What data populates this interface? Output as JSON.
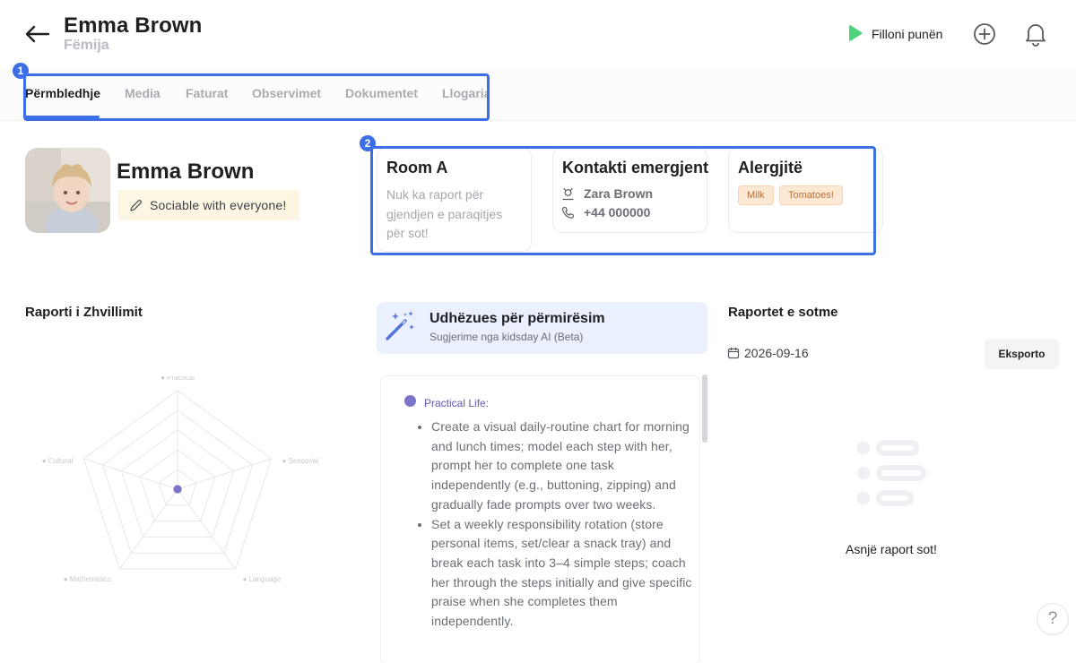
{
  "header": {
    "title": "Emma Brown",
    "subtitle": "Fëmija",
    "start_work_label": "Filloni punën",
    "accent": "#4cd37b"
  },
  "tabs": [
    {
      "label": "Përmbledhje",
      "active": true
    },
    {
      "label": "Media"
    },
    {
      "label": "Faturat"
    },
    {
      "label": "Observimet"
    },
    {
      "label": "Dokumentet"
    },
    {
      "label": "Llogaria"
    }
  ],
  "annotations": [
    "1",
    "2"
  ],
  "profile": {
    "name": "Emma Brown",
    "mood": "Sociable with everyone!"
  },
  "cards": {
    "room": {
      "title": "Room A",
      "text": "Nuk ka raport për gjendjen e paraqitjes për sot!"
    },
    "emergency": {
      "title": "Kontakti emergjent",
      "name": "Zara Brown",
      "phone": "+44 000000"
    },
    "allergies": {
      "title": "Alergjitë",
      "items": [
        "Milk",
        "Tomatoes!"
      ]
    }
  },
  "development": {
    "title": "Raporti i Zhvillimit"
  },
  "chart_data": {
    "type": "radar",
    "axes": [
      "Practical",
      "Sensorial",
      "Language",
      "Mathematics:",
      "Cultural"
    ],
    "values": [
      0,
      0,
      0,
      0,
      0
    ],
    "rings": 5,
    "point_color": "#7b74c9"
  },
  "guidance": {
    "title": "Udhëzues për përmirësim",
    "subtitle": "Sugjerime nga kidsday AI (Beta)",
    "category": "Practical Life:",
    "items": [
      "Create a visual daily-routine chart for morning and lunch times; model each step with her, prompt her to complete one task independently (e.g., buttoning, zipping) and gradually fade prompts over two weeks.",
      "Set a weekly responsibility rotation (store personal items, set/clear a snack tray) and break each task into 3–4 simple steps; coach her through the steps initially and give specific praise when she completes them independently."
    ]
  },
  "reports": {
    "title": "Raportet e sotme",
    "date": "2026-09-16",
    "export_label": "Eksporto",
    "empty_text": "Asnjë raport sot!"
  },
  "help": {
    "label": "?"
  }
}
